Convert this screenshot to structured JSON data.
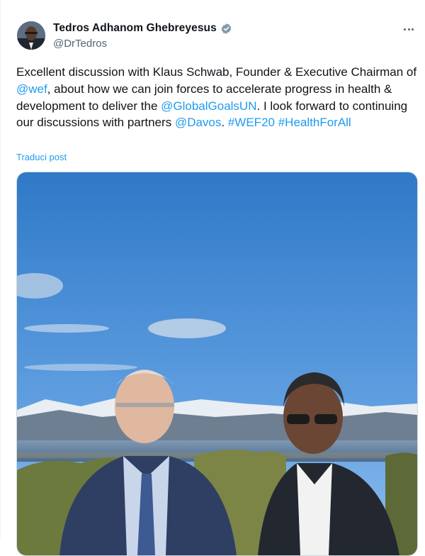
{
  "author": {
    "name": "Tedros Adhanom Ghebreyesus",
    "handle": "@DrTedros",
    "verified_color": "#829aab"
  },
  "tweet": {
    "segments": [
      {
        "text": "Excellent discussion with Klaus Schwab, Founder & Executive Chairman of ",
        "link": false
      },
      {
        "text": "@wef",
        "link": true
      },
      {
        "text": ", about how we can join forces to accelerate progress in health & development to deliver the ",
        "link": false
      },
      {
        "text": "@GlobalGoalsUN",
        "link": true
      },
      {
        "text": ". I look forward to continuing our discussions with partners ",
        "link": false
      },
      {
        "text": "@Davos",
        "link": true
      },
      {
        "text": ". ",
        "link": false
      },
      {
        "text": "#WEF20",
        "link": true
      },
      {
        "text": " ",
        "link": false
      },
      {
        "text": "#HealthForAll",
        "link": true
      }
    ],
    "translate_label": "Traduci post"
  },
  "icons": {
    "more": "more-horizontal-icon",
    "verified": "verified-badge-icon"
  },
  "colors": {
    "link": "#1d9bf0",
    "text": "#0f1419",
    "secondary": "#536471"
  }
}
